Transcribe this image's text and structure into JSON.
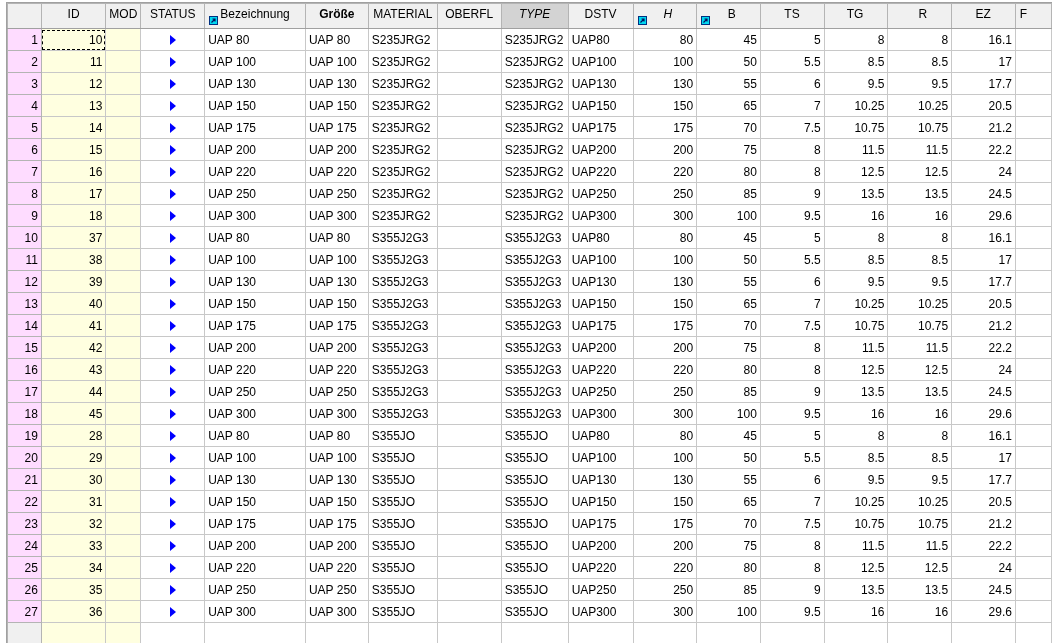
{
  "table": {
    "columns": [
      {
        "label": "ID",
        "kind": "key",
        "selected": false
      },
      {
        "label": "MOD",
        "kind": "key",
        "selected": false
      },
      {
        "label": "STATUS",
        "kind": "status",
        "selected": false
      },
      {
        "label": "Bezeichnung",
        "kind": "text",
        "icon": true,
        "selected": false
      },
      {
        "label": "Größe",
        "kind": "text",
        "selected": false
      },
      {
        "label": "MATERIAL",
        "kind": "text",
        "selected": false
      },
      {
        "label": "OBERFL",
        "kind": "text",
        "selected": false
      },
      {
        "label": "TYPE",
        "kind": "text",
        "selected": true
      },
      {
        "label": "DSTV",
        "kind": "text",
        "selected": false
      },
      {
        "label": "H",
        "kind": "number",
        "icon": true,
        "selected": false
      },
      {
        "label": "B",
        "kind": "number",
        "icon": true,
        "selected": false
      },
      {
        "label": "TS",
        "kind": "number",
        "selected": false
      },
      {
        "label": "TG",
        "kind": "number",
        "selected": false
      },
      {
        "label": "R",
        "kind": "number",
        "selected": false
      },
      {
        "label": "EZ",
        "kind": "number",
        "selected": false
      },
      {
        "label": "F",
        "kind": "number",
        "selected": false
      }
    ],
    "rows": [
      {
        "number": "1",
        "focused": true,
        "cells": [
          "10",
          "",
          "",
          "UAP 80",
          "UAP 80",
          "S235JRG2",
          "",
          "S235JRG2",
          "UAP80",
          "80",
          "45",
          "5",
          "8",
          "8",
          "16.1",
          ""
        ]
      },
      {
        "number": "2",
        "focused": false,
        "cells": [
          "11",
          "",
          "",
          "UAP 100",
          "UAP 100",
          "S235JRG2",
          "",
          "S235JRG2",
          "UAP100",
          "100",
          "50",
          "5.5",
          "8.5",
          "8.5",
          "17",
          ""
        ]
      },
      {
        "number": "3",
        "focused": false,
        "cells": [
          "12",
          "",
          "",
          "UAP 130",
          "UAP 130",
          "S235JRG2",
          "",
          "S235JRG2",
          "UAP130",
          "130",
          "55",
          "6",
          "9.5",
          "9.5",
          "17.7",
          ""
        ]
      },
      {
        "number": "4",
        "focused": false,
        "cells": [
          "13",
          "",
          "",
          "UAP 150",
          "UAP 150",
          "S235JRG2",
          "",
          "S235JRG2",
          "UAP150",
          "150",
          "65",
          "7",
          "10.25",
          "10.25",
          "20.5",
          ""
        ]
      },
      {
        "number": "5",
        "focused": false,
        "cells": [
          "14",
          "",
          "",
          "UAP 175",
          "UAP 175",
          "S235JRG2",
          "",
          "S235JRG2",
          "UAP175",
          "175",
          "70",
          "7.5",
          "10.75",
          "10.75",
          "21.2",
          ""
        ]
      },
      {
        "number": "6",
        "focused": false,
        "cells": [
          "15",
          "",
          "",
          "UAP 200",
          "UAP 200",
          "S235JRG2",
          "",
          "S235JRG2",
          "UAP200",
          "200",
          "75",
          "8",
          "11.5",
          "11.5",
          "22.2",
          ""
        ]
      },
      {
        "number": "7",
        "focused": false,
        "cells": [
          "16",
          "",
          "",
          "UAP 220",
          "UAP 220",
          "S235JRG2",
          "",
          "S235JRG2",
          "UAP220",
          "220",
          "80",
          "8",
          "12.5",
          "12.5",
          "24",
          ""
        ]
      },
      {
        "number": "8",
        "focused": false,
        "cells": [
          "17",
          "",
          "",
          "UAP 250",
          "UAP 250",
          "S235JRG2",
          "",
          "S235JRG2",
          "UAP250",
          "250",
          "85",
          "9",
          "13.5",
          "13.5",
          "24.5",
          ""
        ]
      },
      {
        "number": "9",
        "focused": false,
        "cells": [
          "18",
          "",
          "",
          "UAP 300",
          "UAP 300",
          "S235JRG2",
          "",
          "S235JRG2",
          "UAP300",
          "300",
          "100",
          "9.5",
          "16",
          "16",
          "29.6",
          ""
        ]
      },
      {
        "number": "10",
        "focused": false,
        "cells": [
          "37",
          "",
          "",
          "UAP 80",
          "UAP 80",
          "S355J2G3",
          "",
          "S355J2G3",
          "UAP80",
          "80",
          "45",
          "5",
          "8",
          "8",
          "16.1",
          ""
        ]
      },
      {
        "number": "11",
        "focused": false,
        "cells": [
          "38",
          "",
          "",
          "UAP 100",
          "UAP 100",
          "S355J2G3",
          "",
          "S355J2G3",
          "UAP100",
          "100",
          "50",
          "5.5",
          "8.5",
          "8.5",
          "17",
          ""
        ]
      },
      {
        "number": "12",
        "focused": false,
        "cells": [
          "39",
          "",
          "",
          "UAP 130",
          "UAP 130",
          "S355J2G3",
          "",
          "S355J2G3",
          "UAP130",
          "130",
          "55",
          "6",
          "9.5",
          "9.5",
          "17.7",
          ""
        ]
      },
      {
        "number": "13",
        "focused": false,
        "cells": [
          "40",
          "",
          "",
          "UAP 150",
          "UAP 150",
          "S355J2G3",
          "",
          "S355J2G3",
          "UAP150",
          "150",
          "65",
          "7",
          "10.25",
          "10.25",
          "20.5",
          ""
        ]
      },
      {
        "number": "14",
        "focused": false,
        "cells": [
          "41",
          "",
          "",
          "UAP 175",
          "UAP 175",
          "S355J2G3",
          "",
          "S355J2G3",
          "UAP175",
          "175",
          "70",
          "7.5",
          "10.75",
          "10.75",
          "21.2",
          ""
        ]
      },
      {
        "number": "15",
        "focused": false,
        "cells": [
          "42",
          "",
          "",
          "UAP 200",
          "UAP 200",
          "S355J2G3",
          "",
          "S355J2G3",
          "UAP200",
          "200",
          "75",
          "8",
          "11.5",
          "11.5",
          "22.2",
          ""
        ]
      },
      {
        "number": "16",
        "focused": false,
        "cells": [
          "43",
          "",
          "",
          "UAP 220",
          "UAP 220",
          "S355J2G3",
          "",
          "S355J2G3",
          "UAP220",
          "220",
          "80",
          "8",
          "12.5",
          "12.5",
          "24",
          ""
        ]
      },
      {
        "number": "17",
        "focused": false,
        "cells": [
          "44",
          "",
          "",
          "UAP 250",
          "UAP 250",
          "S355J2G3",
          "",
          "S355J2G3",
          "UAP250",
          "250",
          "85",
          "9",
          "13.5",
          "13.5",
          "24.5",
          ""
        ]
      },
      {
        "number": "18",
        "focused": false,
        "cells": [
          "45",
          "",
          "",
          "UAP 300",
          "UAP 300",
          "S355J2G3",
          "",
          "S355J2G3",
          "UAP300",
          "300",
          "100",
          "9.5",
          "16",
          "16",
          "29.6",
          ""
        ]
      },
      {
        "number": "19",
        "focused": false,
        "cells": [
          "28",
          "",
          "",
          "UAP 80",
          "UAP 80",
          "S355JO",
          "",
          "S355JO",
          "UAP80",
          "80",
          "45",
          "5",
          "8",
          "8",
          "16.1",
          ""
        ]
      },
      {
        "number": "20",
        "focused": false,
        "cells": [
          "29",
          "",
          "",
          "UAP 100",
          "UAP 100",
          "S355JO",
          "",
          "S355JO",
          "UAP100",
          "100",
          "50",
          "5.5",
          "8.5",
          "8.5",
          "17",
          ""
        ]
      },
      {
        "number": "21",
        "focused": false,
        "cells": [
          "30",
          "",
          "",
          "UAP 130",
          "UAP 130",
          "S355JO",
          "",
          "S355JO",
          "UAP130",
          "130",
          "55",
          "6",
          "9.5",
          "9.5",
          "17.7",
          ""
        ]
      },
      {
        "number": "22",
        "focused": false,
        "cells": [
          "31",
          "",
          "",
          "UAP 150",
          "UAP 150",
          "S355JO",
          "",
          "S355JO",
          "UAP150",
          "150",
          "65",
          "7",
          "10.25",
          "10.25",
          "20.5",
          ""
        ]
      },
      {
        "number": "23",
        "focused": false,
        "cells": [
          "32",
          "",
          "",
          "UAP 175",
          "UAP 175",
          "S355JO",
          "",
          "S355JO",
          "UAP175",
          "175",
          "70",
          "7.5",
          "10.75",
          "10.75",
          "21.2",
          ""
        ]
      },
      {
        "number": "24",
        "focused": false,
        "cells": [
          "33",
          "",
          "",
          "UAP 200",
          "UAP 200",
          "S355JO",
          "",
          "S355JO",
          "UAP200",
          "200",
          "75",
          "8",
          "11.5",
          "11.5",
          "22.2",
          ""
        ]
      },
      {
        "number": "25",
        "focused": false,
        "cells": [
          "34",
          "",
          "",
          "UAP 220",
          "UAP 220",
          "S355JO",
          "",
          "S355JO",
          "UAP220",
          "220",
          "80",
          "8",
          "12.5",
          "12.5",
          "24",
          ""
        ]
      },
      {
        "number": "26",
        "focused": false,
        "cells": [
          "35",
          "",
          "",
          "UAP 250",
          "UAP 250",
          "S355JO",
          "",
          "S355JO",
          "UAP250",
          "250",
          "85",
          "9",
          "13.5",
          "13.5",
          "24.5",
          ""
        ]
      },
      {
        "number": "27",
        "focused": false,
        "cells": [
          "36",
          "",
          "",
          "UAP 300",
          "UAP 300",
          "S355JO",
          "",
          "S355JO",
          "UAP300",
          "300",
          "100",
          "9.5",
          "16",
          "16",
          "29.6",
          ""
        ]
      }
    ]
  }
}
